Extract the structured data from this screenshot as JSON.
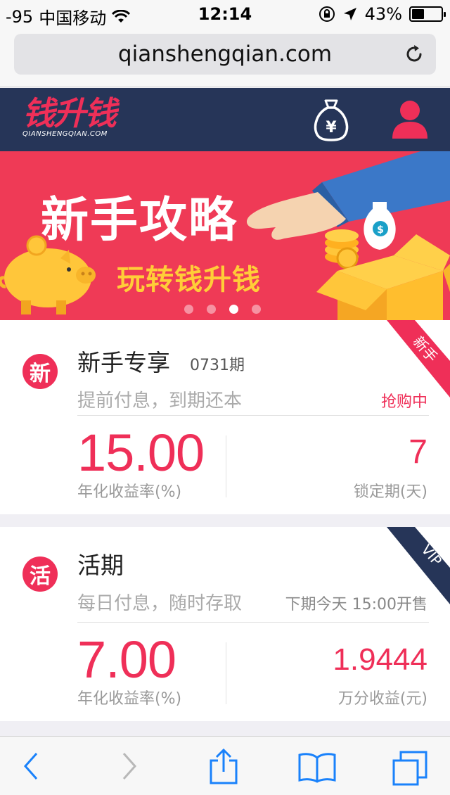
{
  "status_bar": {
    "signal": "-95",
    "carrier": "中国移动",
    "time": "12:14",
    "battery": "43%",
    "battery_level": 0.43
  },
  "browser": {
    "url": "qianshengqian.com"
  },
  "header": {
    "logo_text": "钱升钱",
    "logo_sub": "QIANSHENGQIAN.COM"
  },
  "banner": {
    "title": "新手攻略",
    "subtitle": "玩转钱升钱",
    "slide_count": 4,
    "active_slide": 3
  },
  "products": [
    {
      "badge": "新",
      "name": "新手专享",
      "issue": "0731期",
      "desc": "提前付息，到期还本",
      "status": "抢购中",
      "rate": "15.00",
      "rate_label": "年化收益率(%)",
      "right_value": "7",
      "right_label": "锁定期(天)",
      "ribbon": "新手",
      "ribbon_color": "#ef2f58"
    },
    {
      "badge": "活",
      "name": "活期",
      "issue": "",
      "desc": "每日付息，随时存取",
      "status": "下期今天 15:00开售",
      "rate": "7.00",
      "rate_label": "年化收益率(%)",
      "right_value": "1.9444",
      "right_label": "万分收益(元)",
      "ribbon": "VIP",
      "ribbon_color": "#263558"
    }
  ],
  "colors": {
    "accent": "#ef2f58",
    "navy": "#263558",
    "banner": "#ef3a56",
    "gold": "#ffcd38",
    "ios_blue": "#1a82fb"
  }
}
